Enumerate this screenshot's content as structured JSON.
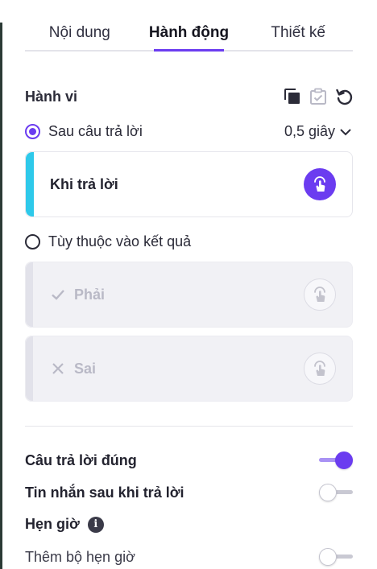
{
  "tabs": [
    {
      "label": "Nội dung",
      "active": false
    },
    {
      "label": "Hành động",
      "active": true
    },
    {
      "label": "Thiết kế",
      "active": false
    }
  ],
  "behavior": {
    "title": "Hành vi",
    "icons": [
      "duplicate-icon",
      "checklist-icon",
      "reset-icon"
    ],
    "after_answer": {
      "label": "Sau câu trả lời",
      "selected": true,
      "delay": "0,5 giây"
    },
    "on_answer_card": {
      "label": "Khi trả lời",
      "accent": "#2ec9ea"
    },
    "depends_on_result": {
      "label": "Tùy thuộc vào kết quả",
      "selected": false
    },
    "correct_card": {
      "label": "Phải"
    },
    "wrong_card": {
      "label": "Sai"
    }
  },
  "settings": {
    "correct_answer": {
      "label": "Câu trả lời đúng",
      "on": true
    },
    "message_after": {
      "label": "Tin nhắn sau khi trả lời",
      "on": false
    },
    "timer": {
      "label": "Hẹn giờ",
      "info": "i"
    },
    "add_timer": {
      "label": "Thêm bộ hẹn giờ",
      "on": false
    }
  },
  "colors": {
    "accent": "#6b3cf0",
    "cyan": "#2ec9ea"
  }
}
